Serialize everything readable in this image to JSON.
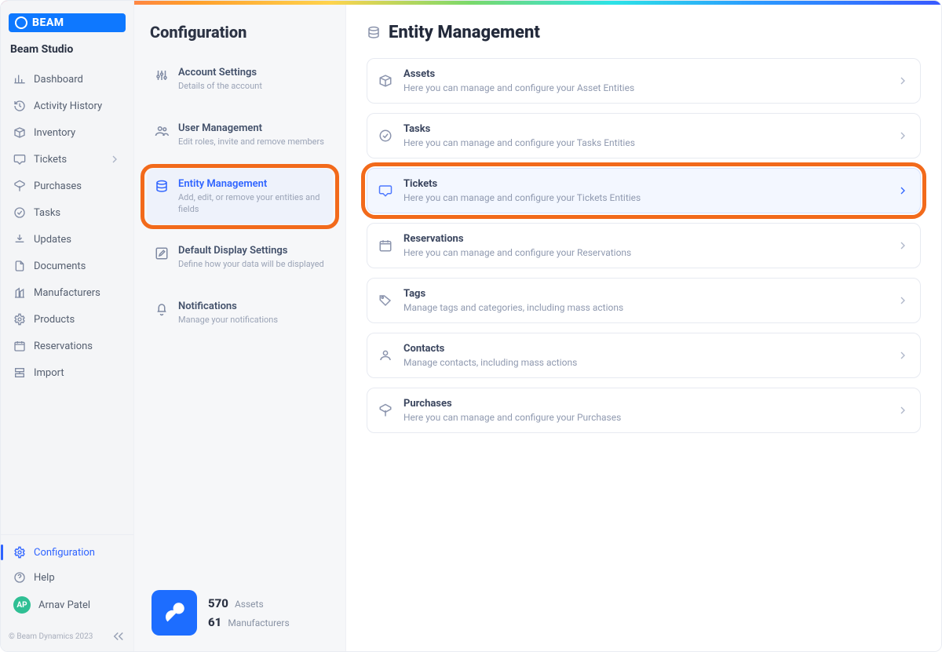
{
  "brand": {
    "logo_text": "BEAM",
    "workspace": "Beam Studio"
  },
  "sidebar": {
    "items": [
      {
        "label": "Dashboard"
      },
      {
        "label": "Activity History"
      },
      {
        "label": "Inventory"
      },
      {
        "label": "Tickets",
        "expandable": true
      },
      {
        "label": "Purchases"
      },
      {
        "label": "Tasks"
      },
      {
        "label": "Updates"
      },
      {
        "label": "Documents"
      },
      {
        "label": "Manufacturers"
      },
      {
        "label": "Products"
      },
      {
        "label": "Reservations"
      },
      {
        "label": "Import"
      }
    ],
    "bottom": [
      {
        "label": "Configuration",
        "active": true
      },
      {
        "label": "Help"
      }
    ],
    "user": {
      "name": "Arnav Patel",
      "initials": "AP"
    },
    "copyright": "© Beam Dynamics 2023"
  },
  "config": {
    "title": "Configuration",
    "items": [
      {
        "title": "Account Settings",
        "subtitle": "Details of the account"
      },
      {
        "title": "User Management",
        "subtitle": "Edit roles, invite and remove members"
      },
      {
        "title": "Entity Management",
        "subtitle": "Add, edit, or remove your entities and fields",
        "active": true,
        "highlight": true
      },
      {
        "title": "Default Display Settings",
        "subtitle": "Define how your data will be displayed"
      },
      {
        "title": "Notifications",
        "subtitle": "Manage your notifications"
      }
    ],
    "footer": {
      "assets_count": "570",
      "assets_label": "Assets",
      "manufacturers_count": "61",
      "manufacturers_label": "Manufacturers"
    }
  },
  "main": {
    "title": "Entity Management",
    "cards": [
      {
        "title": "Assets",
        "subtitle": "Here you can manage and configure your Asset Entities"
      },
      {
        "title": "Tasks",
        "subtitle": "Here you can manage and configure your Tasks Entities"
      },
      {
        "title": "Tickets",
        "subtitle": "Here you can manage and configure your Tickets Entities",
        "selected": true,
        "highlight": true
      },
      {
        "title": "Reservations",
        "subtitle": "Here you can manage and configure your Reservations"
      },
      {
        "title": "Tags",
        "subtitle": "Manage tags and categories, including mass actions"
      },
      {
        "title": "Contacts",
        "subtitle": "Manage contacts, including mass actions"
      },
      {
        "title": "Purchases",
        "subtitle": "Here you can manage and configure your Purchases"
      }
    ]
  }
}
